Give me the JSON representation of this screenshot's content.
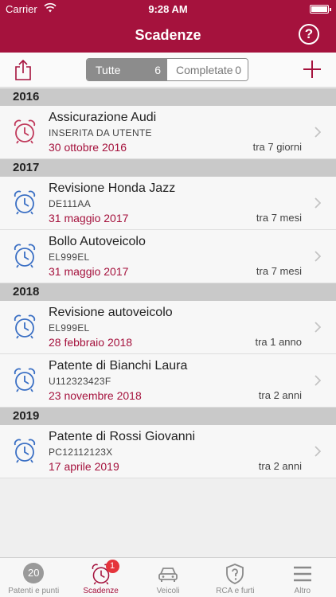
{
  "status_bar": {
    "carrier": "Carrier",
    "time": "9:28 AM"
  },
  "nav": {
    "title": "Scadenze",
    "help_label": "?"
  },
  "toolbar": {
    "segment_all": {
      "label": "Tutte",
      "count": "6"
    },
    "segment_completed": {
      "label": "Completate",
      "count": "0"
    }
  },
  "colors": {
    "accent": "#a5123d",
    "clock_red": "#c0395b",
    "clock_blue": "#3a6fc4",
    "section_bg": "#c9c9c9"
  },
  "sections": [
    {
      "year": "2016",
      "items": [
        {
          "title": "Assicurazione Audi",
          "subtitle": "INSERITA DA UTENTE",
          "date": "30 ottobre 2016",
          "relative": "tra 7 giorni",
          "icon": "alarm-clock-icon",
          "icon_color": "red"
        }
      ]
    },
    {
      "year": "2017",
      "items": [
        {
          "title": "Revisione Honda Jazz",
          "subtitle": "DE111AA",
          "date": "31 maggio 2017",
          "relative": "tra 7 mesi",
          "icon": "alarm-clock-icon",
          "icon_color": "blue"
        },
        {
          "title": "Bollo Autoveicolo",
          "subtitle": "EL999EL",
          "date": "31 maggio 2017",
          "relative": "tra 7 mesi",
          "icon": "alarm-clock-icon",
          "icon_color": "blue"
        }
      ]
    },
    {
      "year": "2018",
      "items": [
        {
          "title": "Revisione autoveicolo",
          "subtitle": "EL999EL",
          "date": "28 febbraio 2018",
          "relative": "tra 1 anno",
          "icon": "alarm-clock-icon",
          "icon_color": "blue"
        },
        {
          "title": "Patente di Bianchi Laura",
          "subtitle": "U112323423F",
          "date": "23 novembre 2018",
          "relative": "tra 2 anni",
          "icon": "alarm-clock-icon",
          "icon_color": "blue"
        }
      ]
    },
    {
      "year": "2019",
      "items": [
        {
          "title": "Patente di Rossi Giovanni",
          "subtitle": "PC12112123X",
          "date": "17 aprile 2019",
          "relative": "tra 2 anni",
          "icon": "alarm-clock-icon",
          "icon_color": "blue"
        }
      ]
    }
  ],
  "tabs": [
    {
      "label": "Patenti e punti",
      "icon": "points-counter-icon",
      "icon_text": "20",
      "active": false
    },
    {
      "label": "Scadenze",
      "icon": "alarm-clock-icon",
      "badge": "1",
      "active": true
    },
    {
      "label": "Veicoli",
      "icon": "car-icon",
      "active": false
    },
    {
      "label": "RCA e furti",
      "icon": "shield-question-icon",
      "active": false
    },
    {
      "label": "Altro",
      "icon": "menu-icon",
      "active": false
    }
  ]
}
